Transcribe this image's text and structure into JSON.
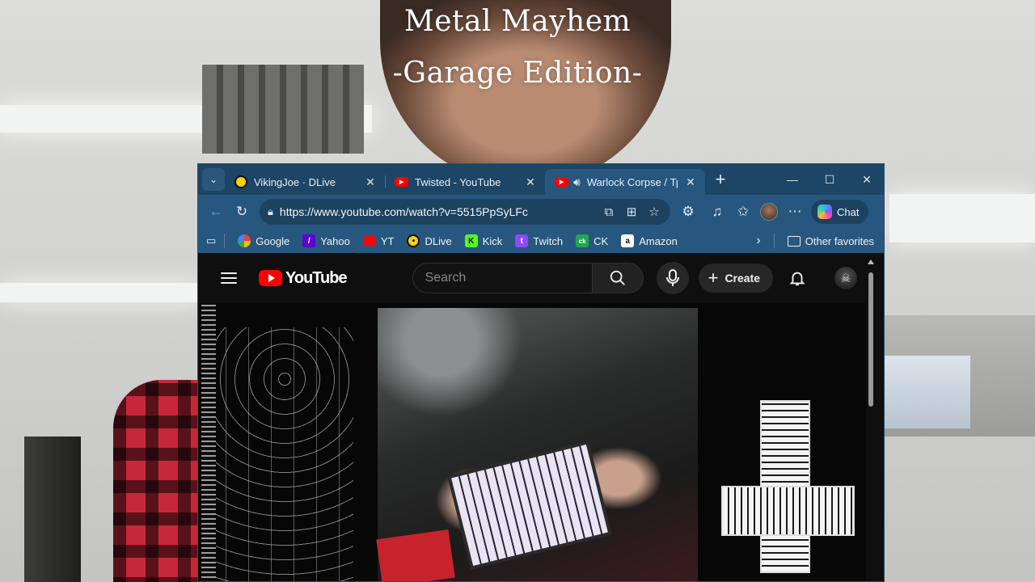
{
  "overlay": {
    "title_line1": "Metal Mayhem",
    "title_line2": "-Garage Edition-"
  },
  "browser": {
    "tabs": [
      {
        "label": "VikingJoe · DLive",
        "icon": "dlive-icon"
      },
      {
        "label": "Twisted - YouTube",
        "icon": "youtube-icon"
      },
      {
        "label": "Warlock Corpse / Трупъ",
        "icon": "youtube-icon",
        "active": true,
        "audio": true
      }
    ],
    "tab_close_glyph": "✕",
    "new_tab_glyph": "+",
    "window_controls": {
      "minimize": "—",
      "maximize": "☐",
      "close": "✕"
    },
    "address_url": "https://www.youtube.com/watch?v=5515PpSyLFc",
    "chat_label": "Chat",
    "favorites": [
      {
        "label": "Google",
        "icon": "google-icon",
        "glyph": ""
      },
      {
        "label": "Yahoo",
        "icon": "yahoo-icon",
        "glyph": "/"
      },
      {
        "label": "YT",
        "icon": "youtube-icon",
        "glyph": ""
      },
      {
        "label": "DLive",
        "icon": "dlive-icon",
        "glyph": "•"
      },
      {
        "label": "Kick",
        "icon": "kick-icon",
        "glyph": "K"
      },
      {
        "label": "Twitch",
        "icon": "twitch-icon",
        "glyph": "t"
      },
      {
        "label": "CK",
        "icon": "ck-icon",
        "glyph": "ck"
      },
      {
        "label": "Amazon",
        "icon": "amazon-icon",
        "glyph": "a"
      }
    ],
    "other_favorites_label": "Other favorites"
  },
  "youtube": {
    "logo_text": "YouTube",
    "search_placeholder": "Search",
    "create_label": "Create"
  }
}
